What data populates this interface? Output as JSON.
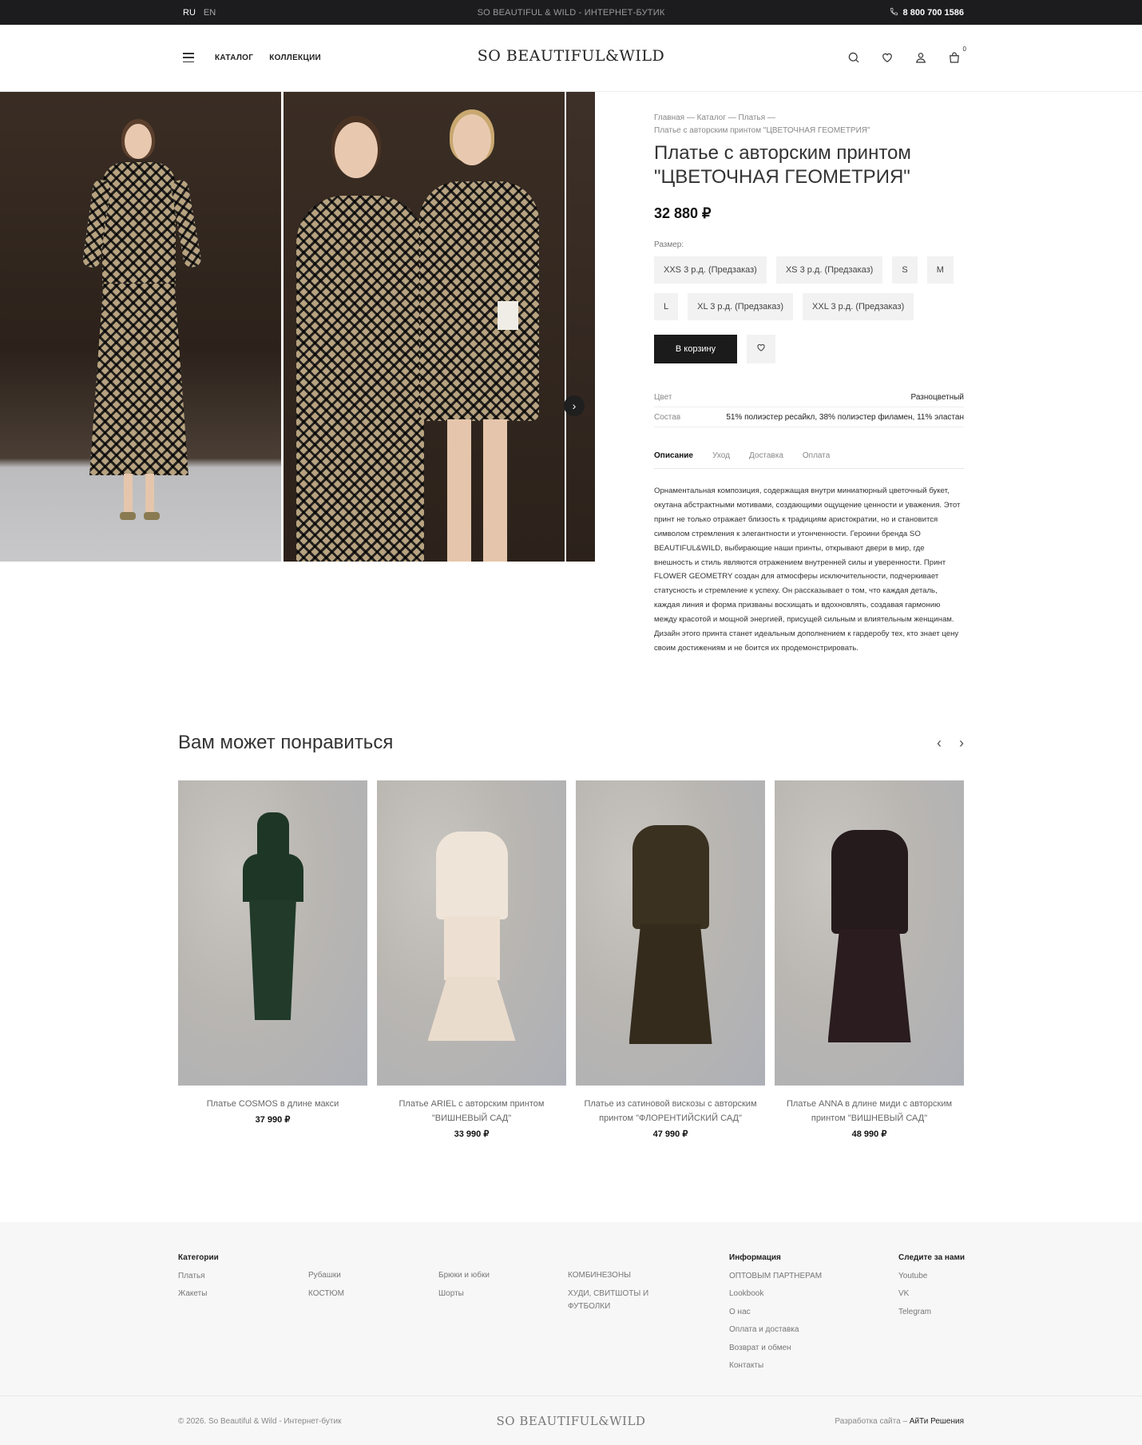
{
  "topbar": {
    "lang_ru": "RU",
    "lang_en": "EN",
    "tagline": "SO BEAUTIFUL & WILD - ИНТЕРНЕТ-БУТИК",
    "phone": "8 800 700 1586"
  },
  "header": {
    "nav": [
      "КАТАЛОГ",
      "КОЛЛЕКЦИИ"
    ],
    "logo": "SO BEAUTIFUL&WILD",
    "cart_count": "0"
  },
  "product": {
    "breadcrumbs": [
      "Главная",
      "Каталог",
      "Платья",
      "Платье с авторским принтом \"ЦВЕТОЧНАЯ ГЕОМЕТРИЯ\""
    ],
    "title": "Платье с авторским принтом \"ЦВЕТОЧНАЯ ГЕОМЕТРИЯ\"",
    "price": "32 880 ₽",
    "size_label": "Размер:",
    "sizes": [
      "XXS 3 р.д. (Предзаказ)",
      "XS 3 р.д. (Предзаказ)",
      "S",
      "M",
      "L",
      "XL 3 р.д. (Предзаказ)",
      "XXL 3 р.д. (Предзаказ)"
    ],
    "add_to_cart": "В корзину",
    "attributes": [
      {
        "key": "Цвет",
        "value": "Разноцветный"
      },
      {
        "key": "Состав",
        "value": "51% полиэстер ресайкл, 38% полиэстер филамен, 11% эластан"
      }
    ],
    "tabs": [
      "Описание",
      "Уход",
      "Доставка",
      "Оплата"
    ],
    "active_tab": "Описание",
    "description": "Орнаментальная композиция, содержащая внутри миниатюрный цветочный букет, окутана абстрактными мотивами, создающими ощущение ценности и уважения. Этот принт не только отражает близость к традициям аристократии, но и становится символом стремления к элегантности и утонченности. Героини бренда SO BEAUTIFUL&WILD, выбирающие наши принты, открывают двери в мир, где внешность и стиль являются отражением внутренней силы и уверенности. Принт FLOWER GEOMETRY создан для атмосферы исключительности, подчеркивает статусность и стремление к успеху. Он рассказывает о том, что каждая деталь, каждая линия и форма призваны восхищать и вдохновлять, создавая гармонию между красотой и мощной энергией, присущей сильным и влиятельным женщинам. Дизайн этого принта станет идеальным дополнением к гардеробу тех, кто знает цену своим достижениям и не боится их продемонстрировать."
  },
  "recommendations": {
    "title": "Вам может понравиться",
    "items": [
      {
        "name": "Платье COSMOS в длине макси",
        "price": "37 990 ₽"
      },
      {
        "name": "Платье ARIEL с авторским принтом \"ВИШНЕВЫЙ САД\"",
        "price": "33 990 ₽"
      },
      {
        "name": "Платье из сатиновой вискозы с авторским принтом \"ФЛОРЕНТИЙСКИЙ САД\"",
        "price": "47 990 ₽"
      },
      {
        "name": "Платье ANNA в длине миди с авторским принтом \"ВИШНЕВЫЙ САД\"",
        "price": "48 990 ₽"
      }
    ]
  },
  "footer": {
    "categories_title": "Категории",
    "categories_col1": [
      "Платья",
      "Жакеты"
    ],
    "categories_col2": [
      "Рубашки",
      "КОСТЮМ"
    ],
    "categories_col3": [
      "Брюки и юбки",
      "Шорты"
    ],
    "categories_col4": [
      "КОМБИНЕЗОНЫ",
      "ХУДИ, СВИТШОТЫ И ФУТБОЛКИ"
    ],
    "info_title": "Информация",
    "info_links": [
      "ОПТОВЫМ ПАРТНЕРАМ",
      "Lookbook",
      "О нас",
      "Оплата и доставка",
      "Возврат и обмен",
      "Контакты"
    ],
    "social_title": "Следите за нами",
    "social_links": [
      "Youtube",
      "VK",
      "Telegram"
    ],
    "copyright": "© 2026. So Beautiful & Wild - Интернет-бутик",
    "logo": "SO BEAUTIFUL&WILD",
    "dev_label": "Разработка сайта –",
    "dev_name": "АйТи Решения"
  },
  "colors": {
    "topbar_bg": "#1c1c1e",
    "button_dark": "#1b1b1b",
    "chip_bg": "#f2f2f2",
    "footer_bg": "#f7f7f7"
  }
}
